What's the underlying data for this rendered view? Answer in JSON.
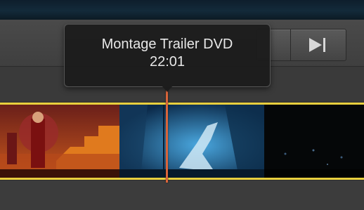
{
  "tooltip": {
    "title": "Montage Trailer DVD",
    "time": "22:01"
  },
  "toolbar": {
    "next_icon": "skip-to-end-icon"
  },
  "timeline": {
    "clips": [
      {
        "name": "clip-dancers-stage"
      },
      {
        "name": "clip-blue-dancer"
      },
      {
        "name": "clip-dark-stage"
      }
    ],
    "selection_color": "#e8cf3e",
    "playhead_color": "#d9643a"
  }
}
